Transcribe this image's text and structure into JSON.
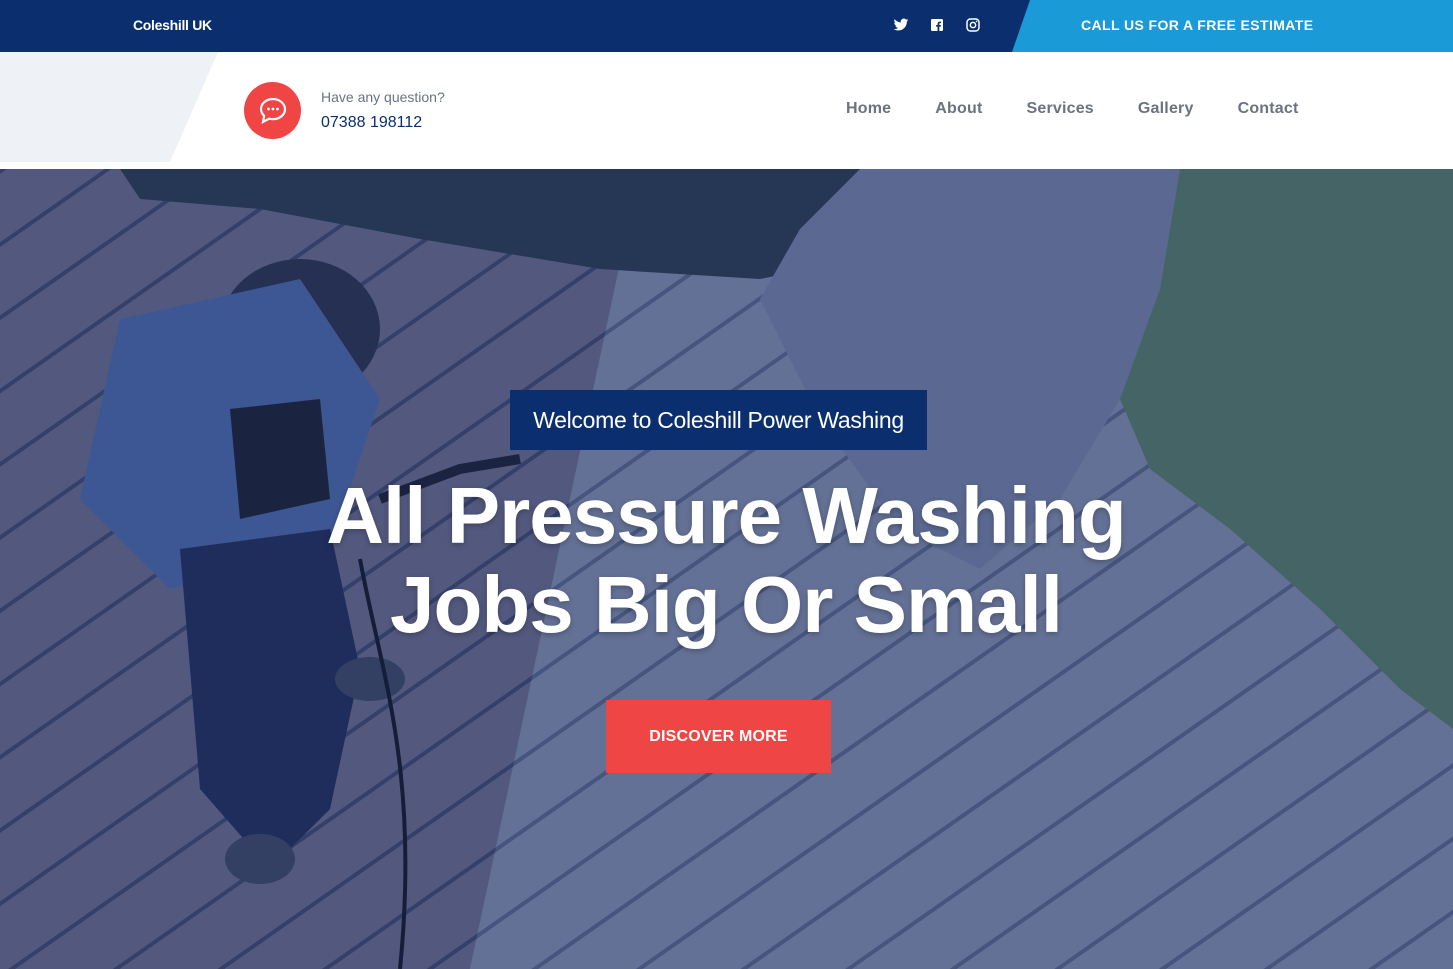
{
  "topbar": {
    "brand": "Coleshill UK",
    "socials": [
      "twitter-icon",
      "facebook-icon",
      "instagram-icon"
    ],
    "cta_label": "CALL US FOR A FREE ESTIMATE"
  },
  "header": {
    "question_label": "Have any question?",
    "phone": "07388 198112",
    "nav": [
      "Home",
      "About",
      "Services",
      "Gallery",
      "Contact"
    ]
  },
  "hero": {
    "welcome": "Welcome to Coleshill Power Washing",
    "headline_line1": "All Pressure Washing",
    "headline_line2": "Jobs Big Or Small",
    "button_label": "DISCOVER MORE"
  },
  "colors": {
    "navy": "#0b2f6e",
    "sky": "#1a9ad6",
    "accent_red": "#f04545",
    "nav_text": "#6b7280"
  }
}
